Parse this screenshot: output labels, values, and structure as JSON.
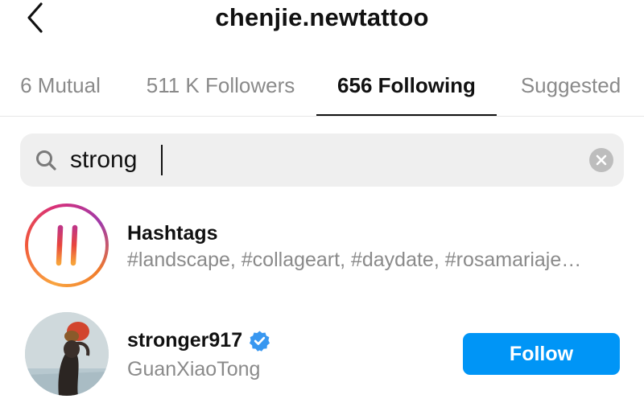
{
  "header": {
    "title": "chenjie.newtattoo",
    "back_icon": "chevron-left-icon"
  },
  "tabs": [
    {
      "label": "6 Mutual",
      "active": false
    },
    {
      "label": "511 K Followers",
      "active": false
    },
    {
      "label": "656 Following",
      "active": true
    },
    {
      "label": "Suggested",
      "active": false
    }
  ],
  "search": {
    "value": "strong",
    "icon": "search-icon",
    "clear_icon": "clear-icon"
  },
  "results": {
    "hashtags": {
      "title": "Hashtags",
      "subtitle": "#landscape, #collageart, #daydate, #rosamariaje…",
      "icon": "hashtag-icon"
    },
    "user": {
      "username": "stronger917",
      "full_name": "GuanXiaoTong",
      "verified": true,
      "follow_label": "Follow"
    }
  },
  "colors": {
    "accent": "#0095f6",
    "secondary_text": "#8a8a8a",
    "search_bg": "#efefef"
  }
}
